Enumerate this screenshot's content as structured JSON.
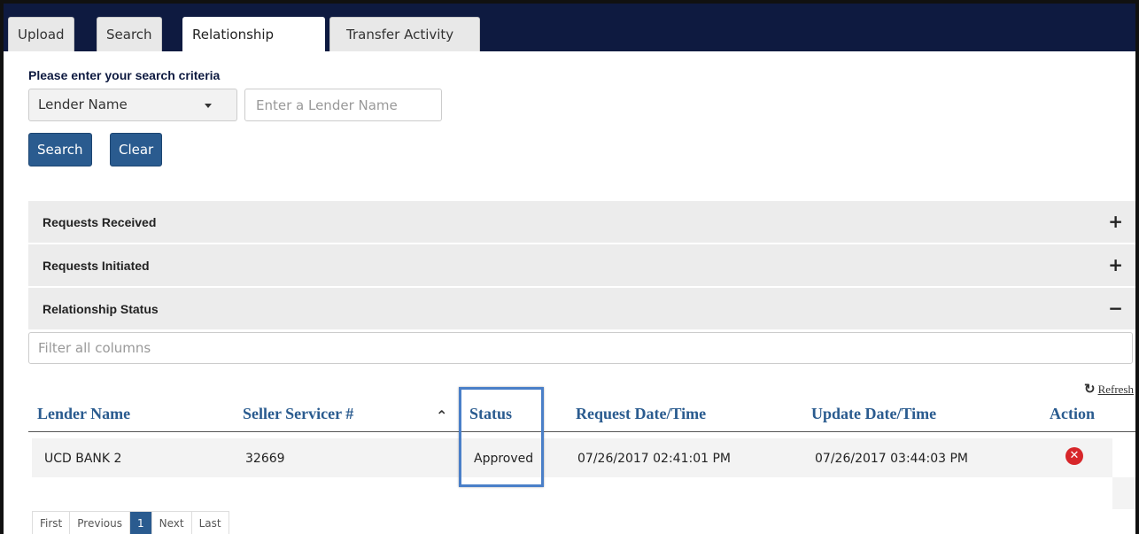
{
  "tabs": [
    {
      "label": "Upload"
    },
    {
      "label": "Search"
    },
    {
      "label": "Relationship",
      "active": true
    },
    {
      "label": "Transfer Activity"
    }
  ],
  "search": {
    "criteria_label": "Please enter your search criteria",
    "field_select": "Lender Name",
    "lender_placeholder": "Enter a Lender Name",
    "search_label": "Search",
    "clear_label": "Clear"
  },
  "panels": {
    "received": {
      "title": "Requests Received",
      "toggle": "+"
    },
    "initiated": {
      "title": "Requests Initiated",
      "toggle": "+"
    },
    "status": {
      "title": "Relationship Status",
      "toggle": "−"
    }
  },
  "table": {
    "filter_placeholder": "Filter all columns",
    "refresh_label": "Refresh",
    "refresh_icon": "↻",
    "sort_icon": "⌃",
    "columns": {
      "lender": "Lender Name",
      "seller": "Seller Servicer #",
      "status": "Status",
      "request": "Request Date/Time",
      "update": "Update Date/Time",
      "action": "Action"
    },
    "rows": [
      {
        "lender": "UCD BANK 2",
        "seller": "32669",
        "status": "Approved",
        "request": "07/26/2017 02:41:01 PM",
        "update": "07/26/2017 03:44:03 PM",
        "action_icon": "✕"
      }
    ]
  },
  "pager": {
    "first": "First",
    "previous": "Previous",
    "current": "1",
    "next": "Next",
    "last": "Last"
  },
  "colors": {
    "tab_bar": "#0e1a40",
    "primary_button": "#2a5b8f",
    "header_text": "#2a5b8f",
    "delete_icon": "#d7262a",
    "highlight": "#4a7fc8"
  }
}
